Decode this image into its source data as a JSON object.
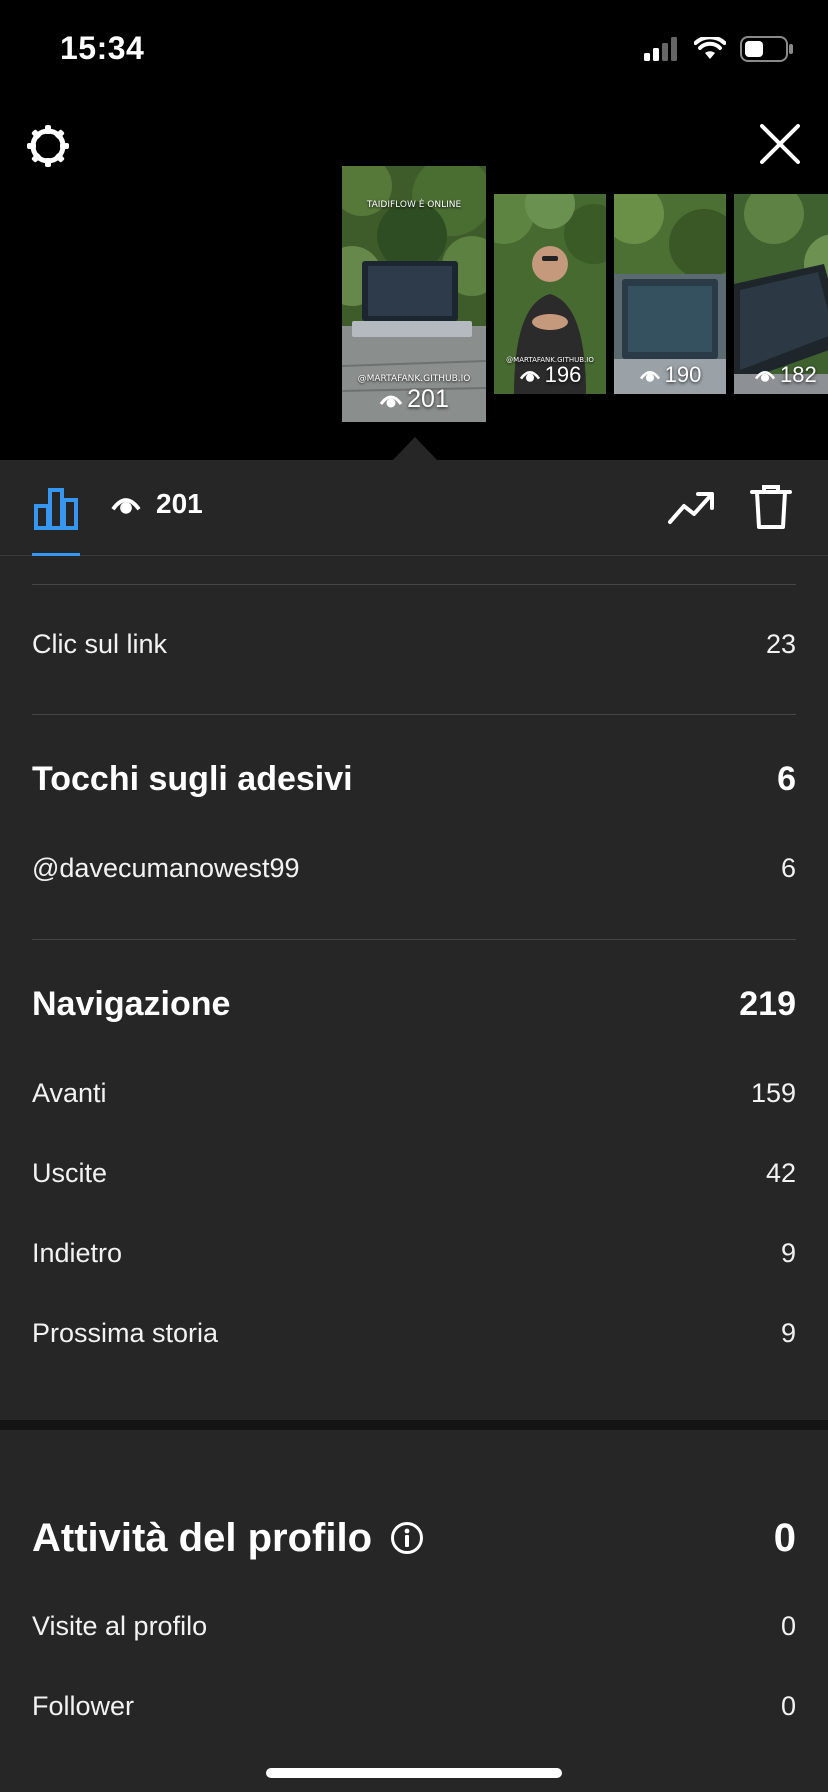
{
  "status_bar": {
    "time": "15:34"
  },
  "header": {
    "thumbnails": [
      {
        "views": "201",
        "caption_top": "TAIDIFLOW È ONLINE",
        "caption_bottom": "@MARTAFANK.GITHUB.IO"
      },
      {
        "views": "196",
        "caption_top": "",
        "caption_bottom": "@MARTAFANK.GITHUB.IO"
      },
      {
        "views": "190",
        "caption_top": "",
        "caption_bottom": ""
      },
      {
        "views": "182",
        "caption_top": "",
        "caption_bottom": ""
      }
    ]
  },
  "tabs": {
    "views_count": "201"
  },
  "stats": {
    "link_clicks": {
      "label": "Clic sul link",
      "value": "23"
    },
    "sticker_taps": {
      "title": "Tocchi sugli adesivi",
      "total": "6",
      "items": [
        {
          "label": "@davecumanowest99",
          "value": "6"
        }
      ]
    },
    "navigation": {
      "title": "Navigazione",
      "total": "219",
      "items": [
        {
          "label": "Avanti",
          "value": "159"
        },
        {
          "label": "Uscite",
          "value": "42"
        },
        {
          "label": "Indietro",
          "value": "9"
        },
        {
          "label": "Prossima storia",
          "value": "9"
        }
      ]
    },
    "profile_activity": {
      "title": "Attività del profilo",
      "total": "0",
      "items": [
        {
          "label": "Visite al profilo",
          "value": "0"
        },
        {
          "label": "Follower",
          "value": "0"
        }
      ]
    }
  },
  "colors": {
    "accent": "#3797f0",
    "panel_bg": "#262626",
    "header_bg": "#000000"
  },
  "icons": [
    "settings-icon",
    "close-icon",
    "eye-icon",
    "bar-chart-icon",
    "trending-up-icon",
    "trash-icon",
    "info-icon"
  ]
}
